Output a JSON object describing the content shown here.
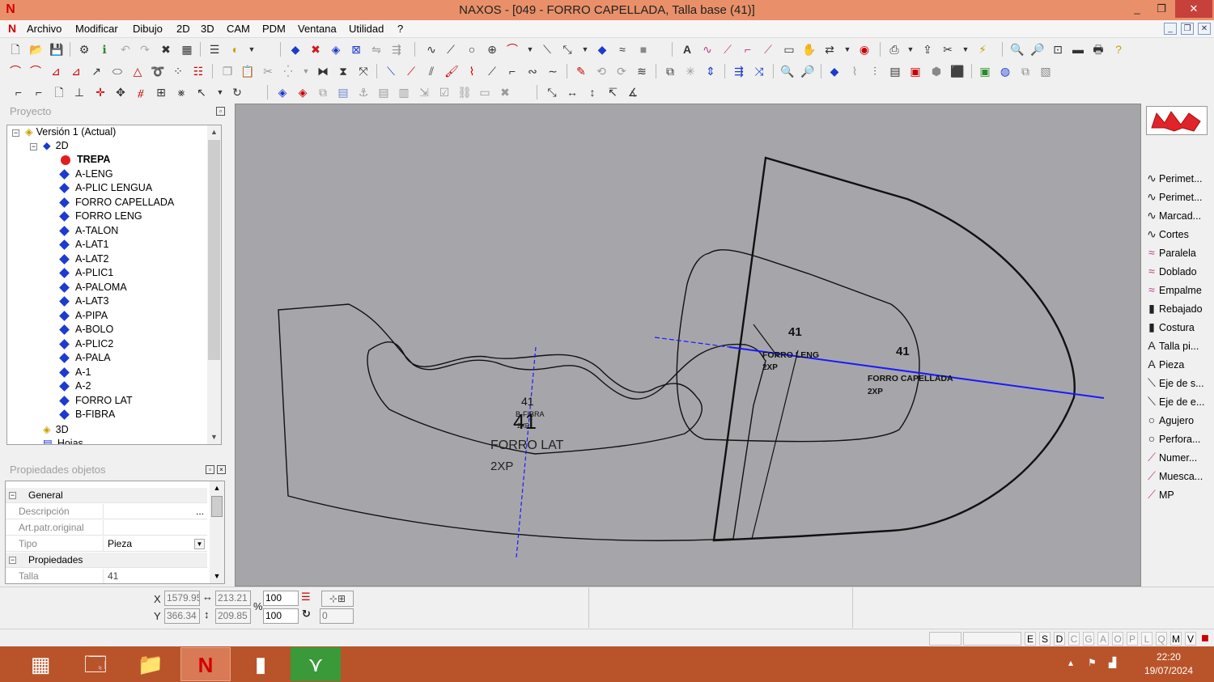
{
  "window": {
    "title": "NAXOS - [049 - FORRO CAPELLADA, Talla base (41)]",
    "app_icon": "naxos-icon",
    "controls": {
      "minimize": "_",
      "restore": "❐",
      "close": "✕"
    }
  },
  "menu": {
    "items": [
      "Archivo",
      "Modificar",
      "Dibujo",
      "2D",
      "3D",
      "CAM",
      "PDM",
      "Ventana",
      "Utilidad",
      "?"
    ],
    "mdi": {
      "minimize": "_",
      "restore": "❐",
      "close": "✕"
    }
  },
  "project_panel": {
    "title": "Proyecto",
    "tree": {
      "version": "Versión 1 (Actual)",
      "folder_2d": "2D",
      "items": [
        {
          "label": "TREPA",
          "icon": "red-dot",
          "bold": true
        },
        {
          "label": "A-LENG",
          "icon": "blue-diamond"
        },
        {
          "label": "A-PLIC LENGUA",
          "icon": "blue-diamond"
        },
        {
          "label": "FORRO CAPELLADA",
          "icon": "blue-diamond"
        },
        {
          "label": "FORRO LENG",
          "icon": "blue-diamond"
        },
        {
          "label": "A-TALON",
          "icon": "blue-diamond"
        },
        {
          "label": "A-LAT1",
          "icon": "blue-diamond"
        },
        {
          "label": "A-LAT2",
          "icon": "blue-diamond"
        },
        {
          "label": "A-PLIC1",
          "icon": "blue-diamond"
        },
        {
          "label": "A-PALOMA",
          "icon": "blue-diamond"
        },
        {
          "label": "A-LAT3",
          "icon": "blue-diamond"
        },
        {
          "label": "A-PIPA",
          "icon": "blue-diamond"
        },
        {
          "label": "A-BOLO",
          "icon": "blue-diamond"
        },
        {
          "label": "A-PLIC2",
          "icon": "blue-diamond"
        },
        {
          "label": "A-PALA",
          "icon": "blue-diamond"
        },
        {
          "label": "A-1",
          "icon": "blue-diamond"
        },
        {
          "label": "A-2",
          "icon": "blue-diamond"
        },
        {
          "label": "FORRO LAT",
          "icon": "blue-diamond"
        },
        {
          "label": "B-FIBRA",
          "icon": "blue-diamond"
        }
      ],
      "folder_3d": "3D",
      "folder_hojas": "Hojas"
    }
  },
  "properties_panel": {
    "title": "Propiedades objetos",
    "sections": {
      "general": "General",
      "propiedades": "Propiedades"
    },
    "rows": {
      "descripcion": {
        "label": "Descripción",
        "value": "",
        "button": "..."
      },
      "art_patr": {
        "label": "Art.patr.original",
        "value": ""
      },
      "tipo": {
        "label": "Tipo",
        "value": "Pieza"
      },
      "talla": {
        "label": "Talla",
        "value": "41"
      }
    }
  },
  "canvas": {
    "background": "#a6a6aa",
    "labels": {
      "size_a": "41",
      "forro_leng": "FORRO LENG",
      "forro_leng_qty": "2XP",
      "size_b": "41",
      "forro_capellada": "FORRO CAPELLADA",
      "forro_capellada_qty": "2XP",
      "size_c": "41",
      "size_big": "41",
      "fibra": "B-FIBRA",
      "fibra_qty": "2XP",
      "forro_lat": "FORRO LAT",
      "forro_lat_qty": "2XP"
    },
    "colors": {
      "outline": "#111111",
      "axis": "#1a1aff"
    }
  },
  "palette": {
    "items": [
      {
        "label": "Perimet...",
        "icon": "curve-icon"
      },
      {
        "label": "Perimet...",
        "icon": "curve-icon"
      },
      {
        "label": "Marcad...",
        "icon": "curve-icon"
      },
      {
        "label": "Cortes",
        "icon": "curve-icon"
      },
      {
        "label": "Paralela",
        "icon": "parallel-curve-icon"
      },
      {
        "label": "Doblado",
        "icon": "fold-icon"
      },
      {
        "label": "Empalme",
        "icon": "join-icon"
      },
      {
        "label": "Rebajado",
        "icon": "skive-icon"
      },
      {
        "label": "Costura",
        "icon": "seam-icon"
      },
      {
        "label": "Talla pi...",
        "icon": "text-icon"
      },
      {
        "label": "Pieza",
        "icon": "text-icon"
      },
      {
        "label": "Eje de s...",
        "icon": "axis-icon"
      },
      {
        "label": "Eje de e...",
        "icon": "axis-icon"
      },
      {
        "label": "Agujero",
        "icon": "circle-icon"
      },
      {
        "label": "Perfora...",
        "icon": "circle-icon"
      },
      {
        "label": "Numer...",
        "icon": "pen-icon"
      },
      {
        "label": "Muesca...",
        "icon": "pen-icon"
      },
      {
        "label": "MP",
        "icon": "pen-icon"
      }
    ]
  },
  "coords": {
    "x_label": "X",
    "y_label": "Y",
    "x_value": "1579.95",
    "y_value": "366.34",
    "width_value": "213.21",
    "height_value": "209.85",
    "percent_label": "%",
    "scale_x": "100",
    "scale_y": "100",
    "angle_value": "0"
  },
  "statusbar": {
    "modes": [
      "E",
      "S",
      "D",
      "C",
      "G",
      "A",
      "O",
      "P",
      "L",
      "Q",
      "M",
      "V"
    ],
    "active_modes": [
      "E",
      "S",
      "D",
      "M",
      "V"
    ]
  },
  "taskbar": {
    "time": "22:20",
    "date": "19/07/2024"
  }
}
